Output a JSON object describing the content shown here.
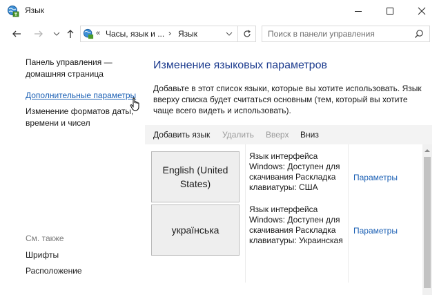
{
  "window": {
    "title": "Язык",
    "icons": {
      "app": "control-panel-globe-icon",
      "minimize": "minimize-icon",
      "maximize": "maximize-icon",
      "close": "close-icon"
    }
  },
  "nav": {
    "icons": {
      "back": "arrow-left-icon",
      "forward": "arrow-right-icon",
      "recent": "chevron-down-icon",
      "up": "arrow-up-icon"
    }
  },
  "address": {
    "chevrons": "«",
    "crumb1": "Часы, язык и ...",
    "separator": "›",
    "crumb2": "Язык",
    "icons": {
      "location": "control-panel-globe-icon",
      "dropdown": "chevron-down-icon",
      "refresh": "refresh-icon"
    }
  },
  "search": {
    "placeholder": "Поиск в панели управления",
    "icon": "search-icon"
  },
  "sidebar": {
    "home": "Панель управления — домашняя страница",
    "advanced": "Дополнительные параметры",
    "formats": "Изменение форматов даты, времени и чисел",
    "see_also": "См. также",
    "fonts": "Шрифты",
    "location": "Расположение"
  },
  "main": {
    "title": "Изменение языковых параметров",
    "description": "Добавьте в этот список языки, которые вы хотите использовать. Язык вверху списка будет считаться основным (тем, который вы хотите чаще всего видеть и использовать).",
    "toolbar": {
      "add": "Добавить язык",
      "delete": "Удалить",
      "up": "Вверх",
      "down": "Вниз"
    },
    "languages": [
      {
        "name": "English (United States)",
        "info": "Язык интерфейса Windows: Доступен для скачивания Раскладка клавиатуры: США",
        "options": "Параметры"
      },
      {
        "name": "українська",
        "info": "Язык интерфейса Windows: Доступен для скачивания Раскладка клавиатуры: Украинская",
        "options": "Параметры"
      }
    ]
  },
  "colors": {
    "link": "#1a5fb4",
    "title": "#1e3d8f",
    "disabled": "#9a9a9a",
    "toolbar_bg": "#f3f3f3"
  }
}
